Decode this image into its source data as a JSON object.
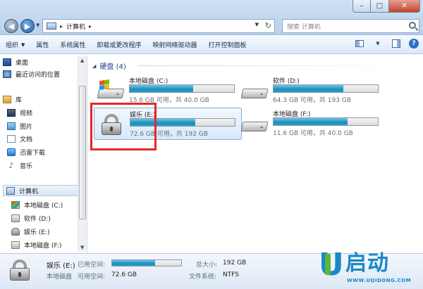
{
  "address_bar": {
    "path_segment": "计算机",
    "search_placeholder": "搜索 计算机"
  },
  "toolbar": {
    "organize": "组织",
    "properties": "属性",
    "system_properties": "系统属性",
    "uninstall": "卸载或更改程序",
    "map_drive": "映射网络驱动器",
    "control_panel": "打开控制面板"
  },
  "nav": {
    "desktop": "桌面",
    "recent": "最近访问的位置",
    "libraries": "库",
    "videos": "视频",
    "pictures": "图片",
    "documents": "文档",
    "thunder": "迅雷下载",
    "music": "音乐",
    "computer": "计算机",
    "drive_c": "本地磁盘 (C:)",
    "drive_d": "软件 (D:)",
    "drive_e": "娱乐 (E:)",
    "drive_f": "本地磁盘 (F:)"
  },
  "content": {
    "group_header": "硬盘 (4)",
    "drives": [
      {
        "name": "本地磁盘 (C:)",
        "info": "15.6 GB 可用，共 40.0 GB",
        "used_fraction": 0.61
      },
      {
        "name": "软件 (D:)",
        "info": "64.3 GB 可用，共 193 GB",
        "used_fraction": 0.67
      },
      {
        "name": "娱乐 (E:)",
        "info": "72.6 GB 可用，共 192 GB",
        "used_fraction": 0.62
      },
      {
        "name": "本地磁盘 (F:)",
        "info": "11.6 GB 可用，共 40.0 GB",
        "used_fraction": 0.71
      }
    ]
  },
  "details": {
    "name": "娱乐 (E:)",
    "type": "本地磁盘",
    "used_label": "已用空间:",
    "free_label": "可用空间:",
    "free_value": "72.6 GB",
    "total_label": "总大小:",
    "total_value": "192 GB",
    "fs_label": "文件系统:",
    "fs_value": "NTFS",
    "used_fraction": 0.62
  },
  "watermark": {
    "letter": "U",
    "text": "启动",
    "url": "WWW.UQIDONG.COM"
  },
  "colors": {
    "accent": "#1c8db9",
    "highlight": "#e8262a",
    "logo": "#1a88c9"
  }
}
